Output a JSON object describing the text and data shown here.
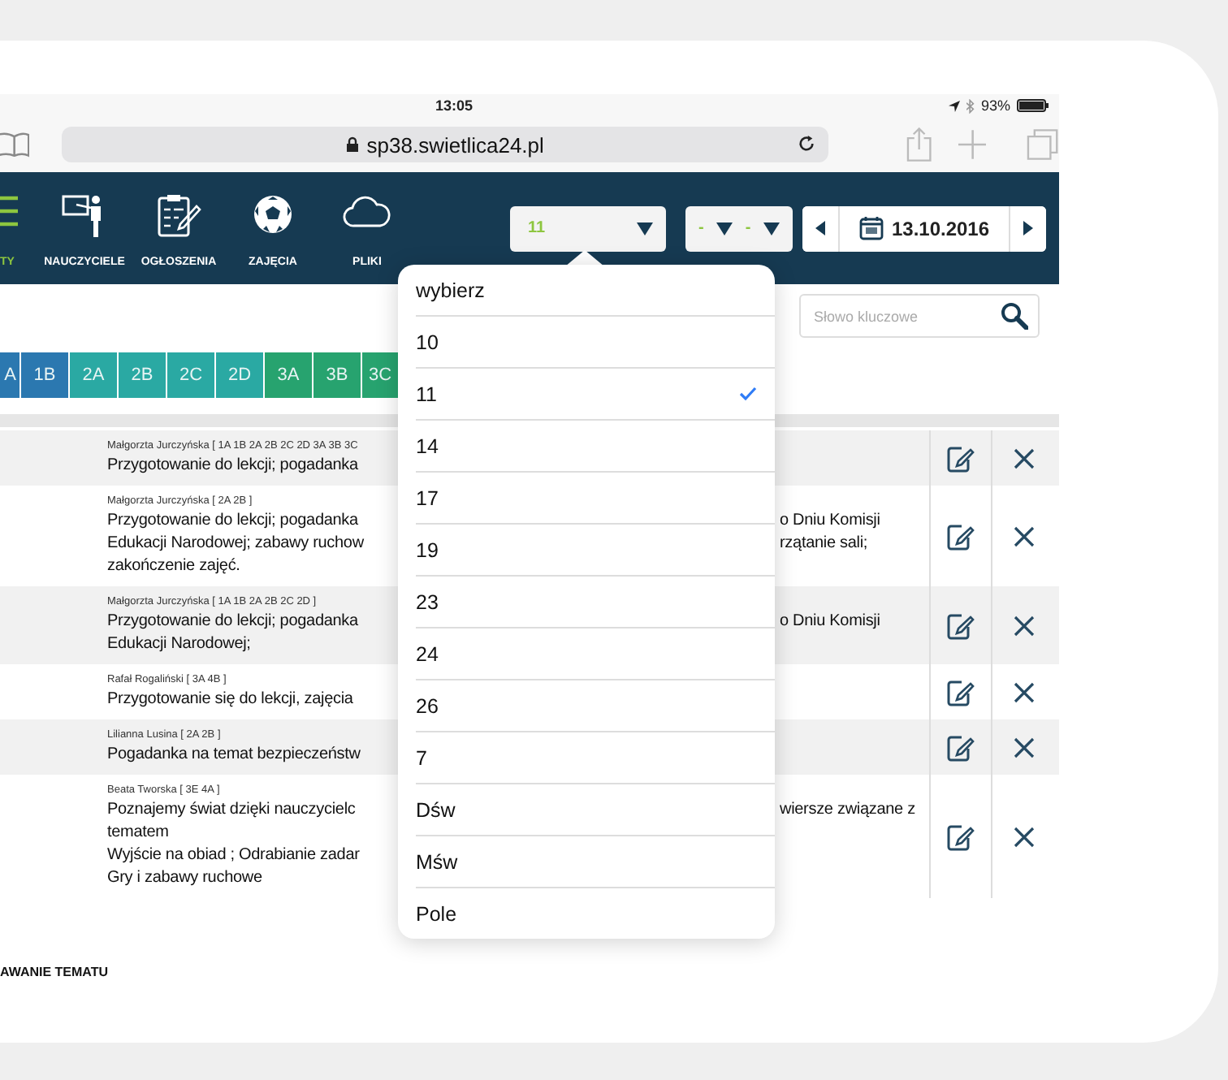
{
  "status_bar": {
    "time": "13:05",
    "battery_text": "93%"
  },
  "browser": {
    "url": "sp38.swietlica24.pl"
  },
  "nav": {
    "items": [
      {
        "label": "TY",
        "selected": true
      },
      {
        "label": "NAUCZYCIELE",
        "selected": false
      },
      {
        "label": "OGŁOSZENIA",
        "selected": false
      },
      {
        "label": "ZAJĘCIA",
        "selected": false
      },
      {
        "label": "PLIKI",
        "selected": false
      }
    ],
    "room_select": {
      "value": "11"
    },
    "time_select": {
      "hour": "-",
      "minute": "-"
    },
    "date": "13.10.2016"
  },
  "search": {
    "placeholder": "Słowo kluczowe"
  },
  "class_tabs": [
    {
      "label": "A",
      "color": "#2b78b0"
    },
    {
      "label": "1B",
      "color": "#2b78b0"
    },
    {
      "label": "2A",
      "color": "#2aa9a3"
    },
    {
      "label": "2B",
      "color": "#2aa9a3"
    },
    {
      "label": "2C",
      "color": "#2aa9a3"
    },
    {
      "label": "2D",
      "color": "#2aa9a3"
    },
    {
      "label": "3A",
      "color": "#27a36f"
    },
    {
      "label": "3B",
      "color": "#27a36f"
    },
    {
      "label": "3C",
      "color": "#27a36f"
    }
  ],
  "entries": [
    {
      "author": "Małgorzta Jurczyńska [ 1A 1B 2A 2B 2C 2D 3A 3B 3C",
      "lines": [
        {
          "left": "Przygotowanie do lekcji; pogadanka"
        }
      ]
    },
    {
      "author": "Małgorzta Jurczyńska [ 2A 2B ]",
      "lines": [
        {
          "left": "Przygotowanie do lekcji; pogadanka",
          "right": "o Dniu Komisji"
        },
        {
          "left": "Edukacji Narodowej; zabawy ruchow",
          "right": "rzątanie sali;"
        },
        {
          "left": "zakończenie zajęć."
        }
      ]
    },
    {
      "author": "Małgorzta Jurczyńska [ 1A 1B 2A 2B 2C 2D ]",
      "lines": [
        {
          "left": "Przygotowanie do lekcji; pogadanka",
          "right": "o Dniu Komisji"
        },
        {
          "left": "Edukacji Narodowej;"
        }
      ]
    },
    {
      "author": "Rafał Rogaliński [ 3A 4B ]",
      "lines": [
        {
          "left": "Przygotowanie się do lekcji, zajęcia"
        }
      ]
    },
    {
      "author": "Lilianna Lusina [ 2A 2B ]",
      "lines": [
        {
          "left": "Pogadanka na temat bezpieczeństw"
        }
      ]
    },
    {
      "author": "Beata Tworska [ 3E 4A ]",
      "lines": [
        {
          "left": "Poznajemy świat dzięki nauczycielc",
          "right": "wiersze związane z"
        },
        {
          "left": "tematem"
        },
        {
          "left": "Wyjście na obiad ; Odrabianie zadar"
        },
        {
          "left": "Gry i zabawy ruchowe"
        }
      ]
    }
  ],
  "section_heading": "AWANIE TEMATU",
  "dropdown": {
    "options": [
      {
        "label": "wybierz",
        "selected": false
      },
      {
        "label": "10",
        "selected": false
      },
      {
        "label": "11",
        "selected": true
      },
      {
        "label": "14",
        "selected": false
      },
      {
        "label": "17",
        "selected": false
      },
      {
        "label": "19",
        "selected": false
      },
      {
        "label": "23",
        "selected": false
      },
      {
        "label": "24",
        "selected": false
      },
      {
        "label": "26",
        "selected": false
      },
      {
        "label": "7",
        "selected": false
      },
      {
        "label": "Dśw",
        "selected": false
      },
      {
        "label": "Mśw",
        "selected": false
      },
      {
        "label": "Pole",
        "selected": false
      }
    ]
  }
}
